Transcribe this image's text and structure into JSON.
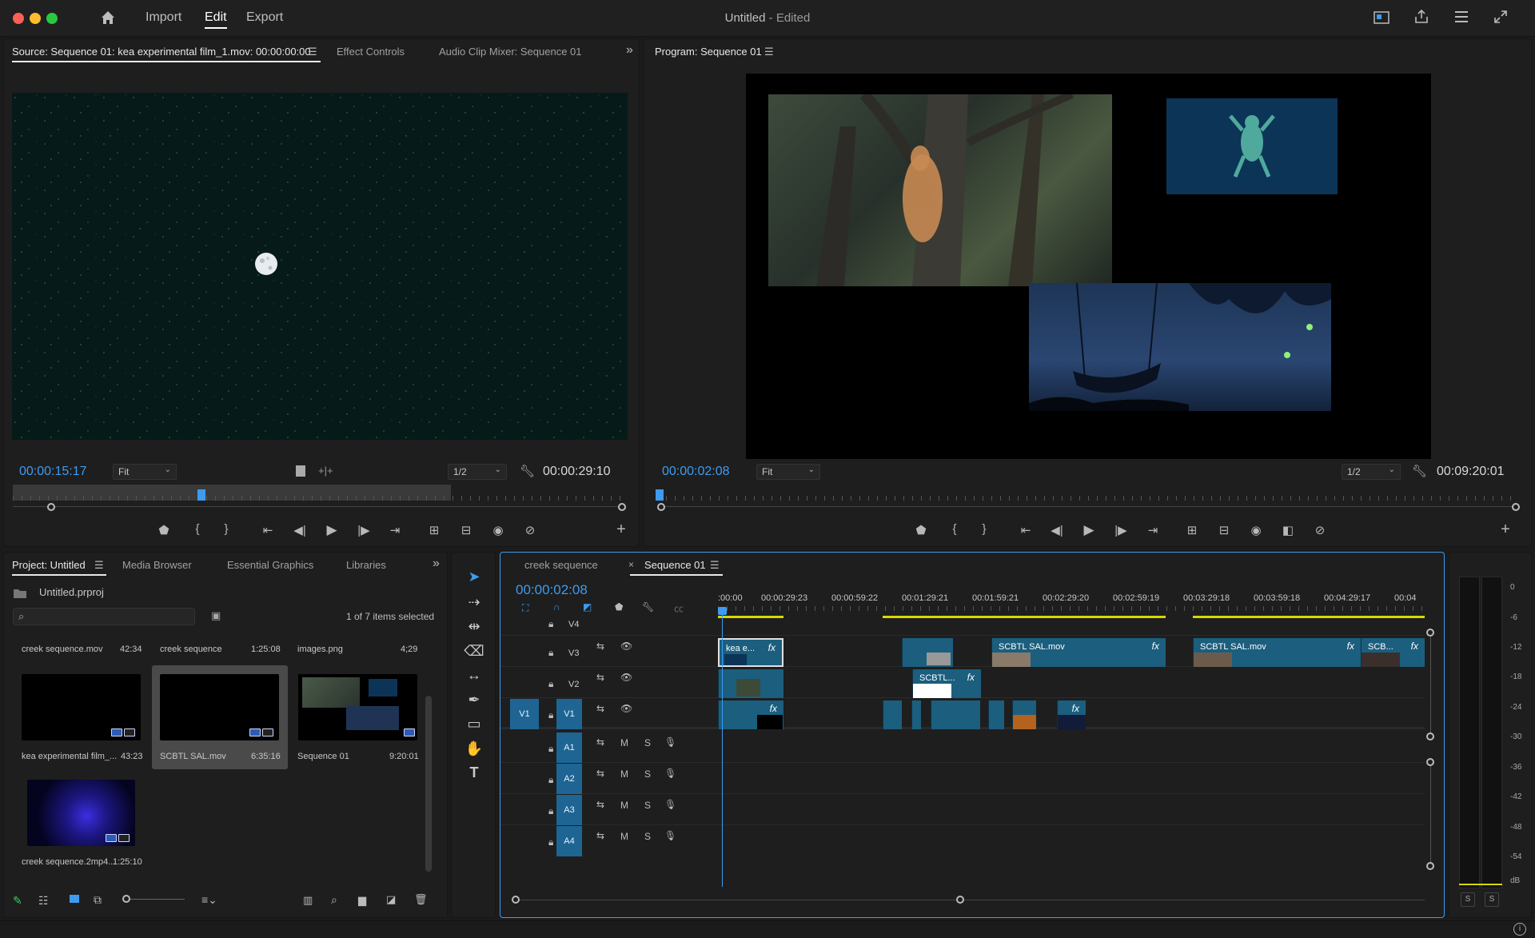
{
  "app": {
    "menu": [
      "Import",
      "Edit",
      "Export"
    ],
    "active_menu": "Edit",
    "title": "Untitled",
    "title_suffix": " - Edited"
  },
  "source_panel": {
    "tabs": [
      "Source: Sequence 01: kea experimental film_1.mov: 00:00:00:00",
      "Effect Controls",
      "Audio Clip Mixer: Sequence 01"
    ],
    "timecode": "00:00:15:17",
    "fit": "Fit",
    "resolution": "1/2",
    "duration": "00:00:29:10"
  },
  "program_panel": {
    "title": "Program: Sequence 01",
    "timecode": "00:00:02:08",
    "fit": "Fit",
    "resolution": "1/2",
    "duration": "00:09:20:01"
  },
  "project_panel": {
    "tabs": [
      "Project: Untitled",
      "Media Browser",
      "Essential Graphics",
      "Libraries"
    ],
    "file": "Untitled.prproj",
    "selection_status": "1 of 7 items selected",
    "items": [
      {
        "name": "creek sequence.mov",
        "duration": "42:34"
      },
      {
        "name": "creek sequence",
        "duration": "1:25:08"
      },
      {
        "name": "images.png",
        "duration": "4;29"
      },
      {
        "name": "kea experimental film_...",
        "duration": "43:23"
      },
      {
        "name": "SCBTL SAL.mov",
        "duration": "6:35:16"
      },
      {
        "name": "Sequence 01",
        "duration": "9:20:01"
      },
      {
        "name": "creek sequence.2mp4...",
        "duration": "1:25:10"
      }
    ]
  },
  "timeline": {
    "tabs": [
      "creek sequence",
      "Sequence 01"
    ],
    "timecode": "00:00:02:08",
    "ruler_labels": [
      ":00:00",
      "00:00:29:23",
      "00:00:59:22",
      "00:01:29:21",
      "00:01:59:21",
      "00:02:29:20",
      "00:02:59:19",
      "00:03:29:18",
      "00:03:59:18",
      "00:04:29:17",
      "00:04"
    ],
    "video_tracks": [
      "V4",
      "V3",
      "V2",
      "V1"
    ],
    "audio_tracks": [
      "A1",
      "A2",
      "A3",
      "A4"
    ],
    "source_patch": "V1",
    "mute_label": "M",
    "solo_label": "S",
    "clips": {
      "v3_a": "kea e...",
      "v3_b": "SCBTL SAL.mov",
      "v3_c": "SCBTL SAL.mov",
      "v3_d": "SCB...",
      "v2_a": "SCBTL...",
      "fx": "fx"
    }
  },
  "audio_meter": {
    "scale": [
      "0",
      "-6",
      "-12",
      "-18",
      "-24",
      "-30",
      "-36",
      "-42",
      "-48",
      "-54",
      "dB"
    ],
    "solo_buttons": [
      "S",
      "S"
    ]
  },
  "colors": {
    "accent_blue": "#3e9bf0",
    "clip_blue": "#1b5e7e",
    "work_area_yellow": "#d8d800"
  }
}
